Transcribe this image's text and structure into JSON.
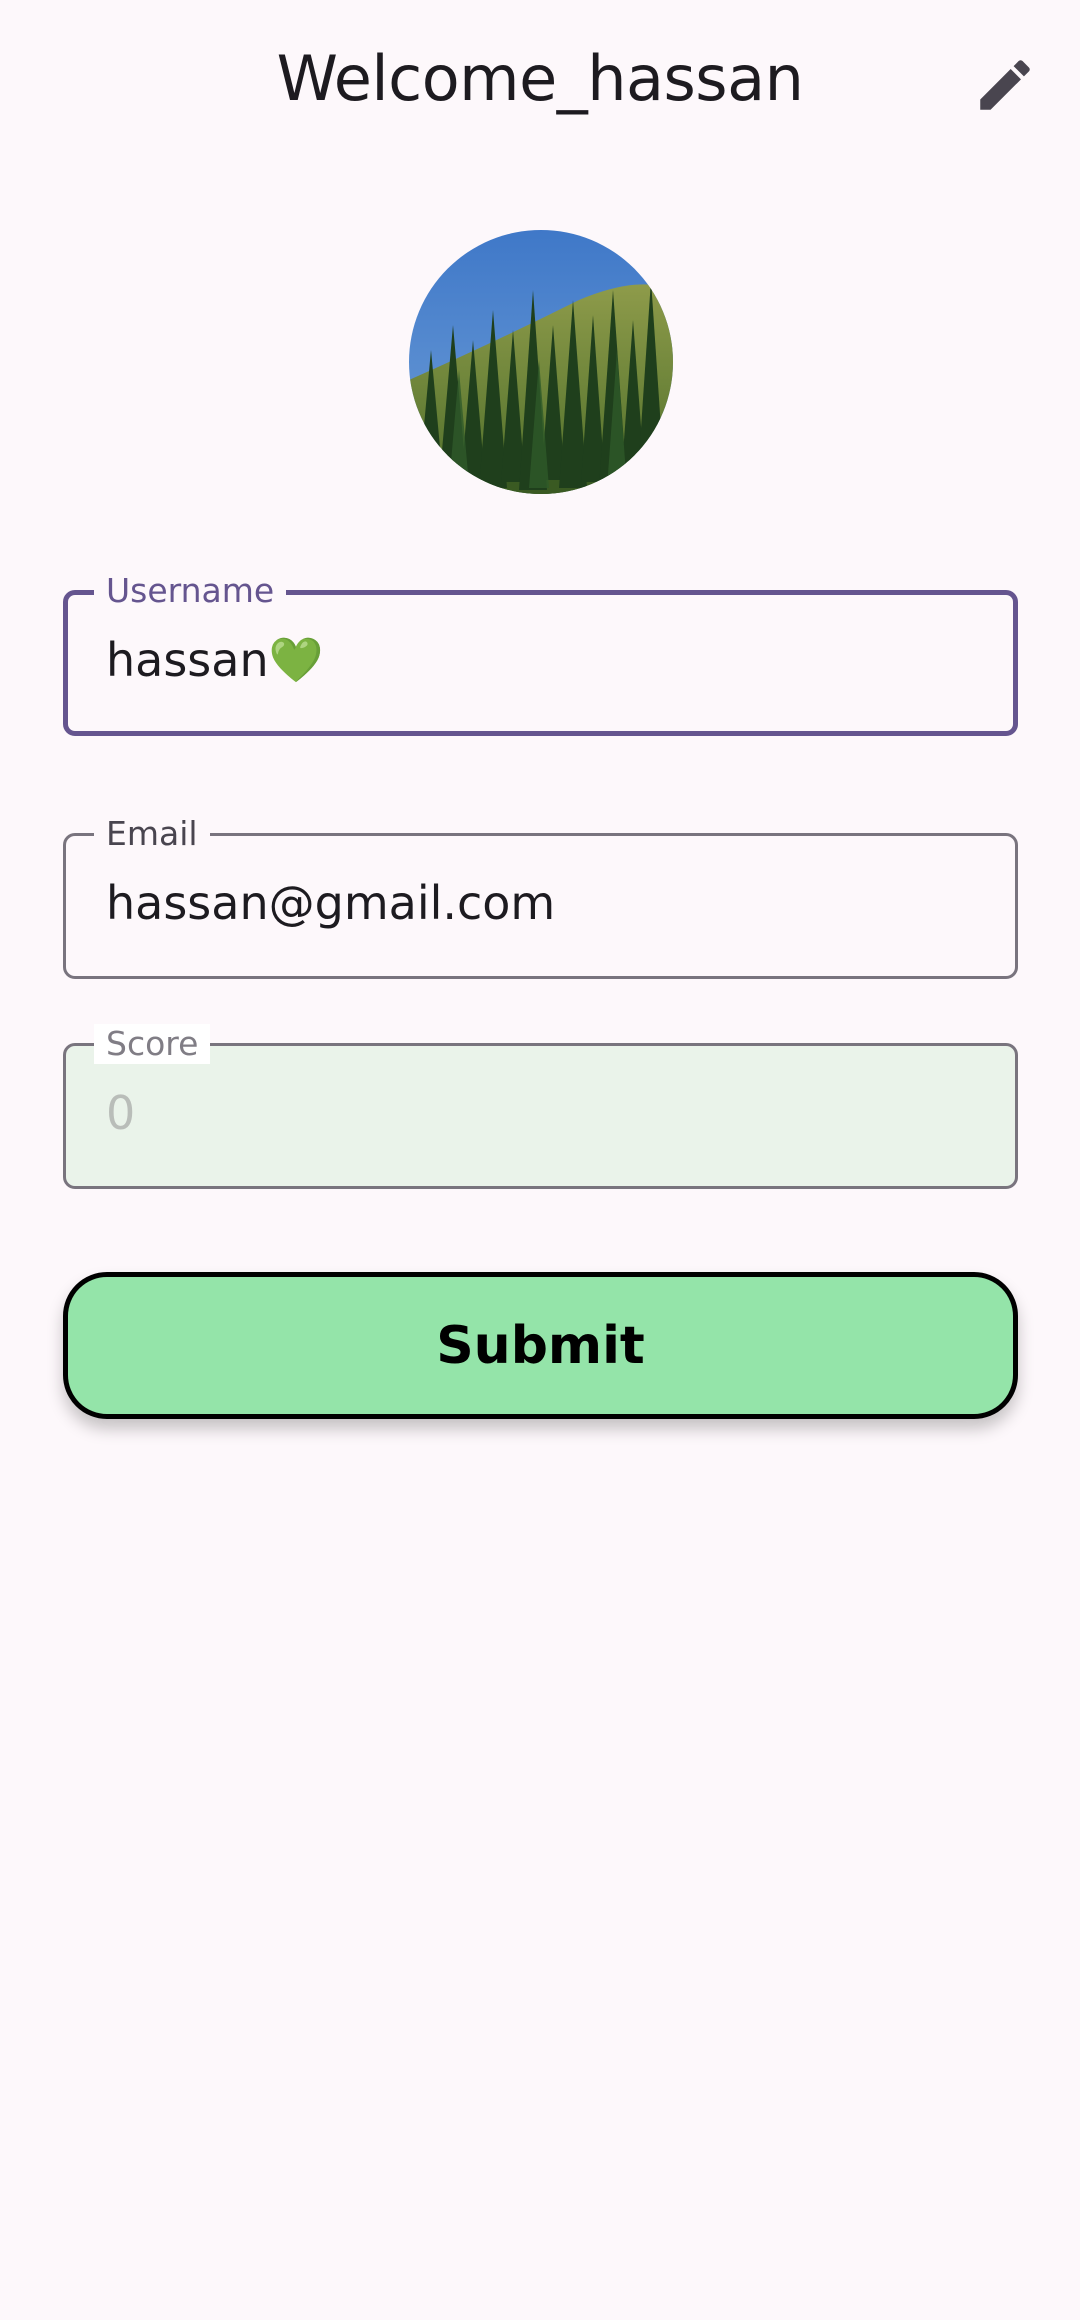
{
  "appbar": {
    "title": "Welcome_hassan",
    "edit_icon": "pencil-edit-icon"
  },
  "profile": {
    "avatar_description": "avatar-photo"
  },
  "form": {
    "username": {
      "label": "Username",
      "value": "hassan",
      "emoji": "💚"
    },
    "email": {
      "label": "Email",
      "value": "hassan@gmail.com"
    },
    "score": {
      "label": "Score",
      "value": "0"
    },
    "submit_label": "Submit"
  },
  "colors": {
    "background": "#fdf8fb",
    "focus_outline": "#65558f",
    "outline": "#79747e",
    "disabled_fill": "#eaf3ea",
    "submit_fill": "#94e4a9",
    "submit_border": "#000000"
  }
}
